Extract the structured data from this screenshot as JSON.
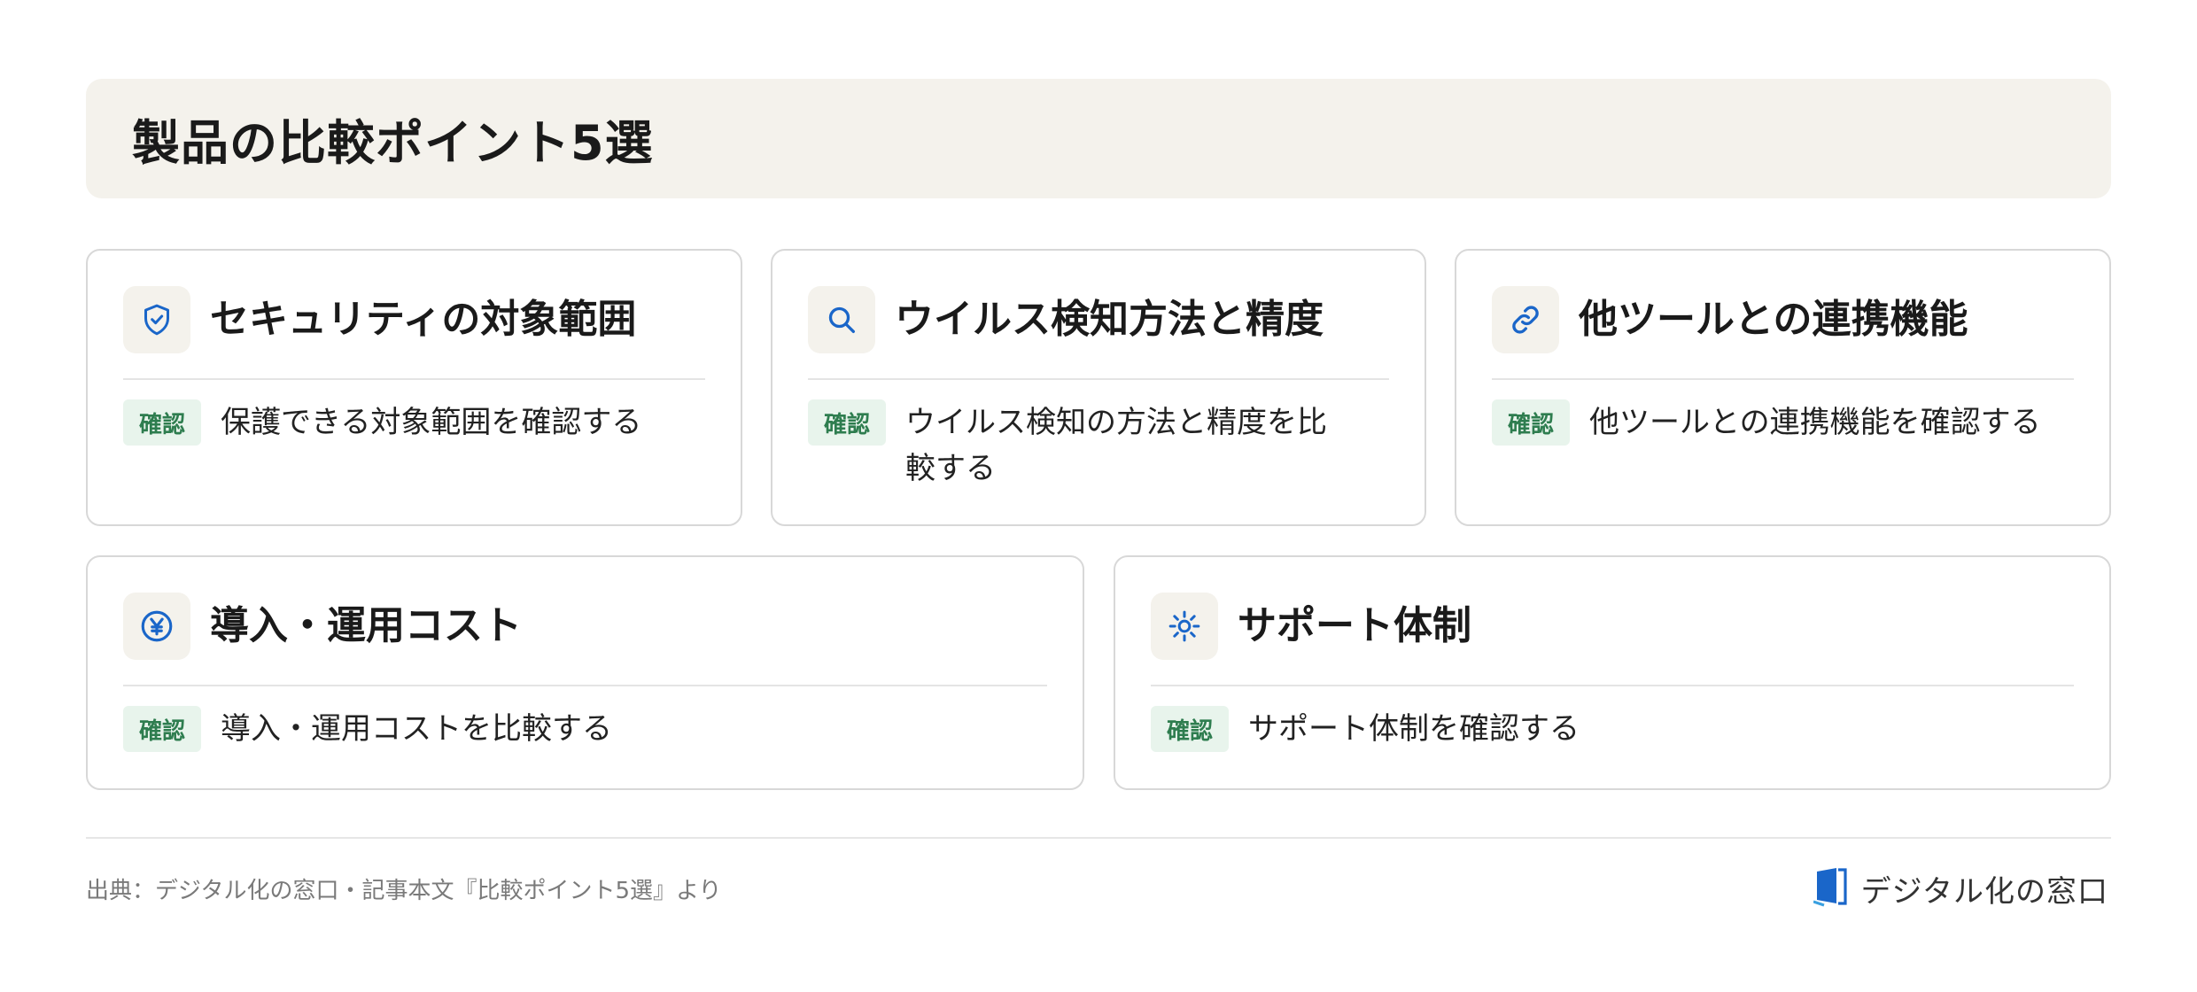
{
  "title": "製品の比較ポイント5選",
  "badge_label": "確認",
  "cards": [
    {
      "title": "セキュリティの対象範囲",
      "text": "保護できる対象範囲を確認する",
      "icon": "shield-check-icon"
    },
    {
      "title": "ウイルス検知方法と精度",
      "text": "ウイルス検知の方法と精度を比較する",
      "icon": "search-icon"
    },
    {
      "title": "他ツールとの連携機能",
      "text": "他ツールとの連携機能を確認する",
      "icon": "link-icon"
    },
    {
      "title": "導入・運用コスト",
      "text": "導入・運用コストを比較する",
      "icon": "yen-icon"
    },
    {
      "title": "サポート体制",
      "text": "サポート体制を確認する",
      "icon": "sun-icon"
    }
  ],
  "footer": {
    "source": "出典：デジタル化の窓口・記事本文『比較ポイント5選』より",
    "brand": "デジタル化の窓口"
  },
  "colors": {
    "accent": "#1a66c9",
    "badge_bg": "#e8f4ec",
    "badge_text": "#2e7d4f",
    "banner_bg": "#f4f2ec"
  }
}
